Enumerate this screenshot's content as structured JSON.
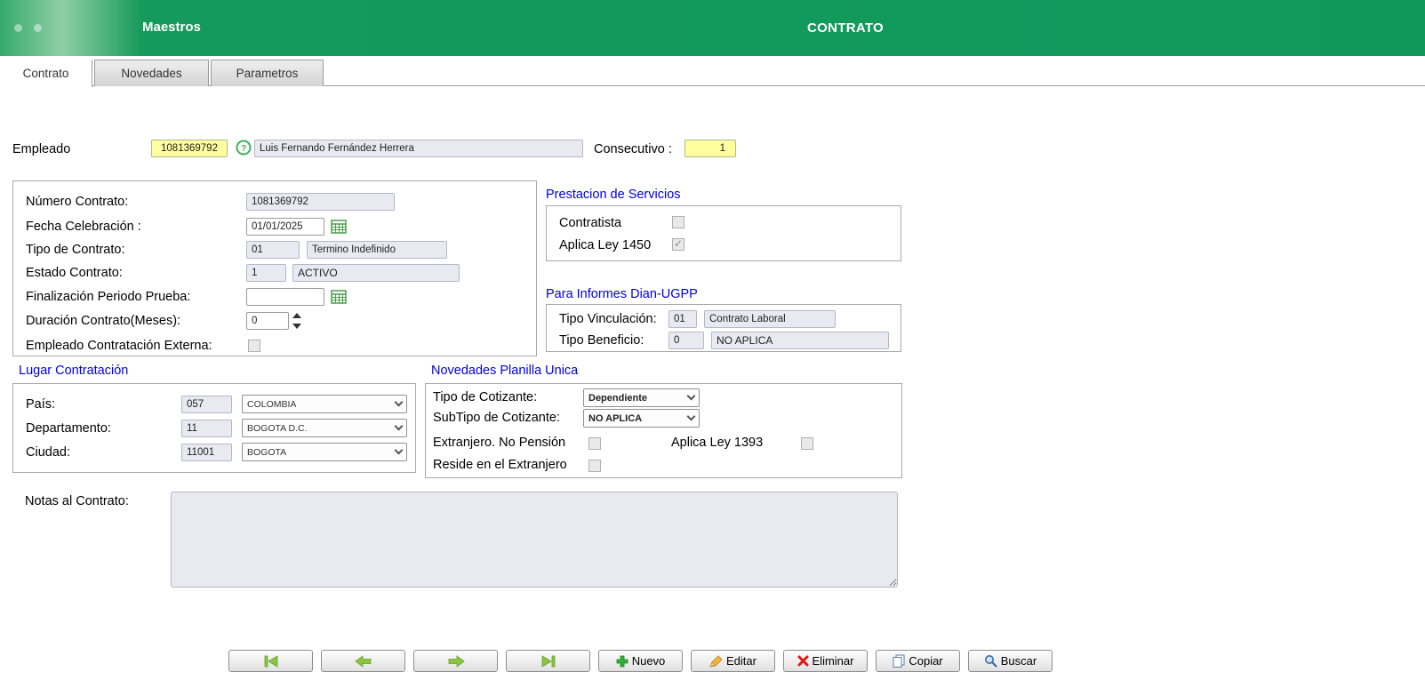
{
  "colors": {
    "header_green": "#0e995b",
    "highlight_yellow": "#ffff9e",
    "section_blue": "#0000dd",
    "field_bg": "#e9e9f2"
  },
  "header": {
    "app_title": "Maestros",
    "page_title": "CONTRATO"
  },
  "tabs": [
    {
      "label": "Contrato",
      "active": true
    },
    {
      "label": "Novedades",
      "active": false
    },
    {
      "label": "Parametros",
      "active": false
    }
  ],
  "employee": {
    "label": "Empleado",
    "code": "1081369792",
    "name": "Luis Fernando Fernández Herrera",
    "consecutive_label": "Consecutivo :",
    "consecutive_value": "1"
  },
  "contract": {
    "numero_label": "Número Contrato:",
    "numero_value": "1081369792",
    "fecha_label": "Fecha Celebración :",
    "fecha_value": "01/01/2025",
    "tipo_label": "Tipo de Contrato:",
    "tipo_code": "01",
    "tipo_desc": "Termino Indefinido",
    "estado_label": "Estado Contrato:",
    "estado_code": "1",
    "estado_desc": "ACTIVO",
    "finalizacion_label": "Finalización Periodo Prueba:",
    "finalizacion_value": "",
    "duracion_label": "Duración Contrato(Meses):",
    "duracion_value": "0",
    "externa_label": "Empleado Contratación Externa:",
    "externa_checked": false
  },
  "prestacion": {
    "title": "Prestacion de Servicios",
    "contratista_label": "Contratista",
    "contratista_checked": false,
    "ley1450_label": "Aplica Ley 1450",
    "ley1450_checked": true
  },
  "dian": {
    "title": "Para Informes Dian-UGPP",
    "vinculacion_label": "Tipo Vinculación:",
    "vinculacion_code": "01",
    "vinculacion_desc": "Contrato Laboral",
    "beneficio_label": "Tipo Beneficio:",
    "beneficio_code": "0",
    "beneficio_desc": "NO APLICA"
  },
  "lugar": {
    "title": "Lugar Contratación",
    "pais_label": "País:",
    "pais_code": "057",
    "pais_value": "COLOMBIA",
    "departamento_label": "Departamento:",
    "departamento_code": "11",
    "departamento_value": "BOGOTA D.C.",
    "ciudad_label": "Ciudad:",
    "ciudad_code": "11001",
    "ciudad_value": "BOGOTA"
  },
  "planilla": {
    "title": "Novedades Planilla Unica",
    "cotizante_label": "Tipo de Cotizante:",
    "cotizante_value": "Dependiente",
    "subtipo_label": "SubTipo de Cotizante:",
    "subtipo_value": "NO APLICA",
    "extranjero_label": "Extranjero. No Pensión",
    "extranjero_checked": false,
    "ley1393_label": "Aplica Ley 1393",
    "ley1393_checked": false,
    "reside_label": "Reside en el Extranjero",
    "reside_checked": false
  },
  "notas": {
    "label": "Notas al Contrato:",
    "value": ""
  },
  "toolbar": {
    "nuevo": "Nuevo",
    "editar": "Editar",
    "eliminar": "Eliminar",
    "copiar": "Copiar",
    "buscar": "Buscar"
  }
}
